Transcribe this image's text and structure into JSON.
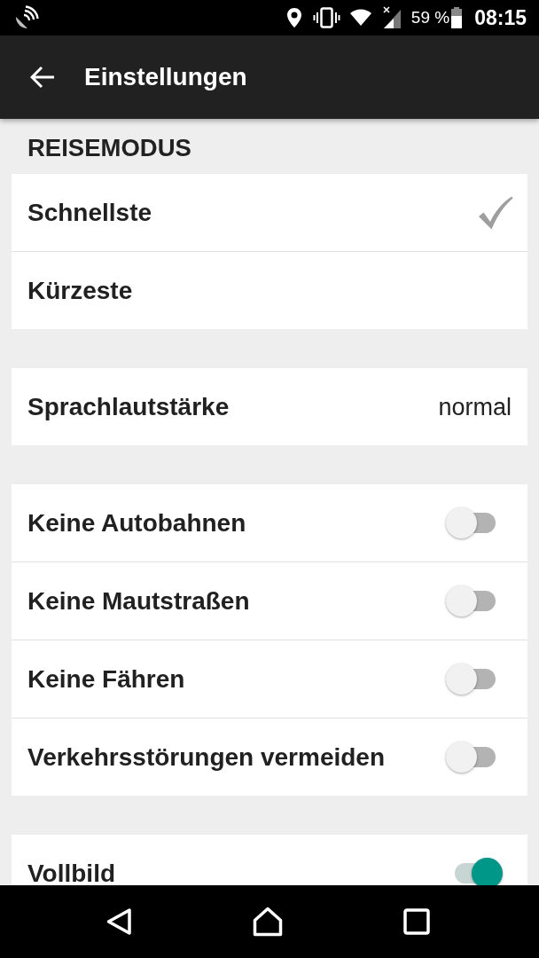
{
  "status_bar": {
    "battery": "59 %",
    "time": "08:15"
  },
  "app_bar": {
    "title": "Einstellungen"
  },
  "sections": [
    {
      "header": "REISEMODUS",
      "items": [
        {
          "kind": "choice",
          "label": "Schnellste",
          "selected": true
        },
        {
          "kind": "choice",
          "label": "Kürzeste",
          "selected": false
        }
      ]
    },
    {
      "items": [
        {
          "kind": "value",
          "label": "Sprachlautstärke",
          "value": "normal"
        }
      ]
    },
    {
      "items": [
        {
          "kind": "switch",
          "label": "Keine Autobahnen",
          "on": false
        },
        {
          "kind": "switch",
          "label": "Keine Mautstraßen",
          "on": false
        },
        {
          "kind": "switch",
          "label": "Keine Fähren",
          "on": false
        },
        {
          "kind": "switch",
          "label": "Verkehrsstörungen vermeiden",
          "on": false
        }
      ]
    },
    {
      "items": [
        {
          "kind": "switch",
          "label": "Vollbild",
          "on": true
        }
      ]
    }
  ]
}
